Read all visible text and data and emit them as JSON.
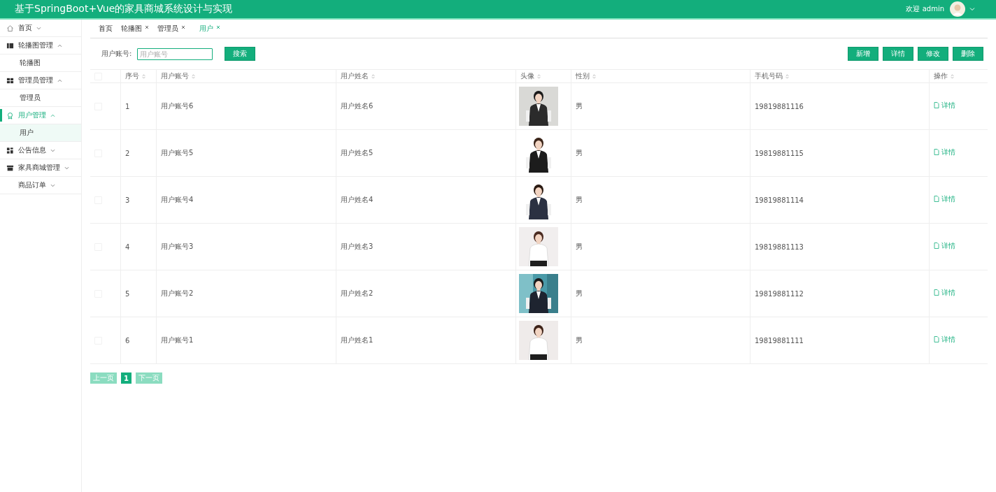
{
  "header": {
    "title": "基于SpringBoot+Vue的家具商城系统设计与实现",
    "welcome": "欢迎 admin"
  },
  "sidebar": {
    "items": [
      {
        "label": "首页",
        "expanded": false,
        "selected": false
      },
      {
        "label": "轮播图管理",
        "expanded": true,
        "selected": false,
        "children": [
          {
            "label": "轮播图",
            "selected": false
          }
        ]
      },
      {
        "label": "管理员管理",
        "expanded": true,
        "selected": false,
        "children": [
          {
            "label": "管理员",
            "selected": false
          }
        ]
      },
      {
        "label": "用户管理",
        "expanded": true,
        "selected": true,
        "children": [
          {
            "label": "用户",
            "selected": true
          }
        ]
      },
      {
        "label": "公告信息",
        "expanded": false,
        "selected": false
      },
      {
        "label": "家具商城管理",
        "expanded": false,
        "selected": false
      },
      {
        "label": "商品订单",
        "expanded": false,
        "selected": false
      }
    ]
  },
  "tabs": [
    {
      "label": "首页",
      "closable": false,
      "selected": false
    },
    {
      "label": "轮播图",
      "closable": true,
      "selected": false
    },
    {
      "label": "管理员",
      "closable": true,
      "selected": false
    },
    {
      "label": "用户",
      "closable": true,
      "selected": true
    }
  ],
  "search": {
    "label": "用户账号:",
    "placeholder": "用户账号",
    "button": "搜索"
  },
  "actions": [
    "新增",
    "详情",
    "修改",
    "删除"
  ],
  "table": {
    "all_checked": false,
    "columns": [
      "序号",
      "用户账号",
      "用户姓名",
      "头像",
      "性别",
      "手机号码",
      "操作"
    ],
    "rows": [
      {
        "checked": false,
        "index": "1",
        "account": "用户账号6",
        "name": "用户姓名6",
        "gender": "男",
        "phone": "19819881116",
        "action": "详情"
      },
      {
        "checked": false,
        "index": "2",
        "account": "用户账号5",
        "name": "用户姓名5",
        "gender": "男",
        "phone": "19819881115",
        "action": "详情"
      },
      {
        "checked": false,
        "index": "3",
        "account": "用户账号4",
        "name": "用户姓名4",
        "gender": "男",
        "phone": "19819881114",
        "action": "详情"
      },
      {
        "checked": false,
        "index": "4",
        "account": "用户账号3",
        "name": "用户姓名3",
        "gender": "男",
        "phone": "19819881113",
        "action": "详情"
      },
      {
        "checked": false,
        "index": "5",
        "account": "用户账号2",
        "name": "用户姓名2",
        "gender": "男",
        "phone": "19819881112",
        "action": "详情"
      },
      {
        "checked": false,
        "index": "6",
        "account": "用户账号1",
        "name": "用户姓名1",
        "gender": "男",
        "phone": "19819881111",
        "action": "详情"
      }
    ]
  },
  "pagination": {
    "prev": "上一页",
    "pages": [
      {
        "label": "1",
        "selected": true
      }
    ],
    "next": "下一页"
  }
}
